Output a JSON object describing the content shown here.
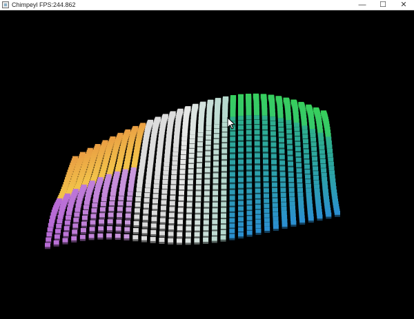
{
  "window": {
    "title": "Chimpeyl FPS:244.862",
    "minimize_glyph": "—",
    "maximize_glyph": "☐",
    "close_glyph": "✕"
  },
  "icons": {
    "app": "app-icon",
    "cursor": "mouse-cursor-icon"
  },
  "scene": {
    "background": "#000000",
    "palette": [
      "#b86bd6",
      "#f2c24a",
      "#e07a3c",
      "#e8e8e8",
      "#36c96a",
      "#2db08a",
      "#2b8fd0",
      "#3adf3a"
    ]
  }
}
